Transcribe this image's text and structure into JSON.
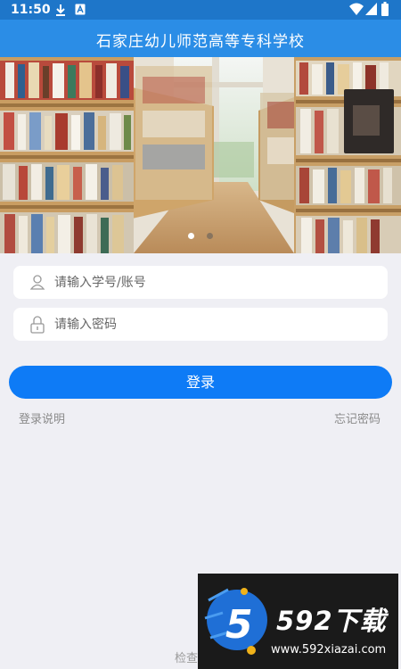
{
  "status_bar": {
    "time": "11:50",
    "icons": [
      "download-icon",
      "notification-a-icon",
      "wifi-icon",
      "signal-icon",
      "battery-icon"
    ]
  },
  "app_bar": {
    "title": "石家庄幼儿师范高等专科学校"
  },
  "banner": {
    "dots": 2,
    "active_dot": 0
  },
  "login_form": {
    "username_placeholder": "请输入学号/账号",
    "password_placeholder": "请输入密码",
    "login_label": "登录",
    "help_link": "登录说明",
    "forgot_link": "忘记密码"
  },
  "footer": {
    "text": "检查"
  },
  "watermark": {
    "brand": "592下载",
    "url": "www.592xiazai.com",
    "logo_digit": "5"
  },
  "colors": {
    "status_bar": "#1e76c9",
    "app_bar": "#2b8de6",
    "button": "#0e7bf6",
    "background": "#efeff4"
  }
}
